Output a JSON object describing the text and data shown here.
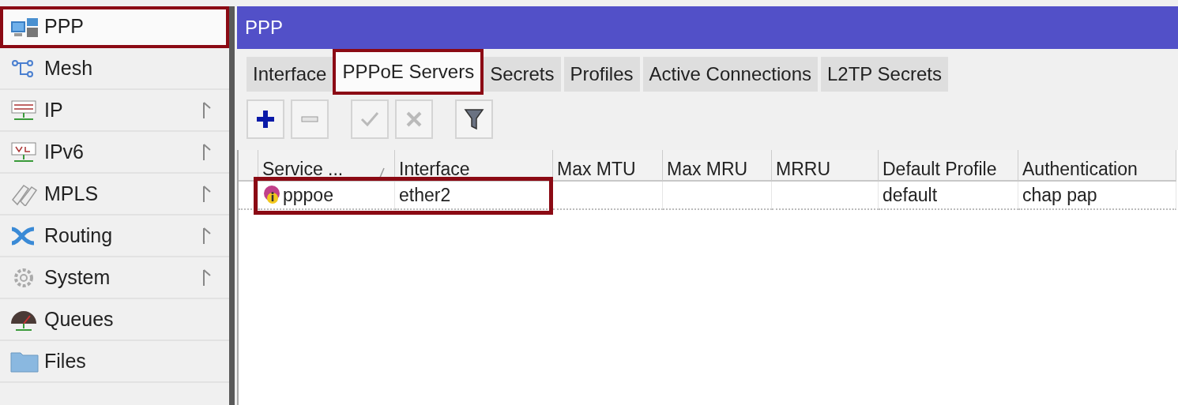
{
  "sidebar": {
    "items": [
      {
        "label": "PPP",
        "submenu": false,
        "highlighted": true
      },
      {
        "label": "Mesh",
        "submenu": false,
        "highlighted": false
      },
      {
        "label": "IP",
        "submenu": true,
        "highlighted": false
      },
      {
        "label": "IPv6",
        "submenu": true,
        "highlighted": false
      },
      {
        "label": "MPLS",
        "submenu": true,
        "highlighted": false
      },
      {
        "label": "Routing",
        "submenu": true,
        "highlighted": false
      },
      {
        "label": "System",
        "submenu": true,
        "highlighted": false
      },
      {
        "label": "Queues",
        "submenu": false,
        "highlighted": false
      },
      {
        "label": "Files",
        "submenu": false,
        "highlighted": false
      }
    ]
  },
  "window": {
    "title": "PPP",
    "tabs": [
      {
        "label": "Interface",
        "selected": false,
        "highlighted": false
      },
      {
        "label": "PPPoE Servers",
        "selected": true,
        "highlighted": true
      },
      {
        "label": "Secrets",
        "selected": false,
        "highlighted": false
      },
      {
        "label": "Profiles",
        "selected": false,
        "highlighted": false
      },
      {
        "label": "Active Connections",
        "selected": false,
        "highlighted": false
      },
      {
        "label": "L2TP Secrets",
        "selected": false,
        "highlighted": false
      }
    ],
    "toolbar": [
      {
        "kind": "add",
        "disabled": false
      },
      {
        "kind": "remove",
        "disabled": false
      },
      {
        "kind": "enable",
        "disabled": true
      },
      {
        "kind": "disable",
        "disabled": true
      },
      {
        "kind": "filter",
        "disabled": false
      }
    ],
    "table": {
      "columns": [
        {
          "label": "Service ...",
          "sorted": true
        },
        {
          "label": "Interface",
          "sorted": false
        },
        {
          "label": "Max MTU",
          "sorted": false
        },
        {
          "label": "Max MRU",
          "sorted": false
        },
        {
          "label": "MRRU",
          "sorted": false
        },
        {
          "label": "Default Profile",
          "sorted": false
        },
        {
          "label": "Authentication",
          "sorted": false
        }
      ],
      "rows": [
        {
          "cells": [
            "pppoe",
            "ether2",
            null,
            null,
            null,
            "default",
            "chap pap"
          ],
          "highlighted": true
        }
      ]
    }
  }
}
